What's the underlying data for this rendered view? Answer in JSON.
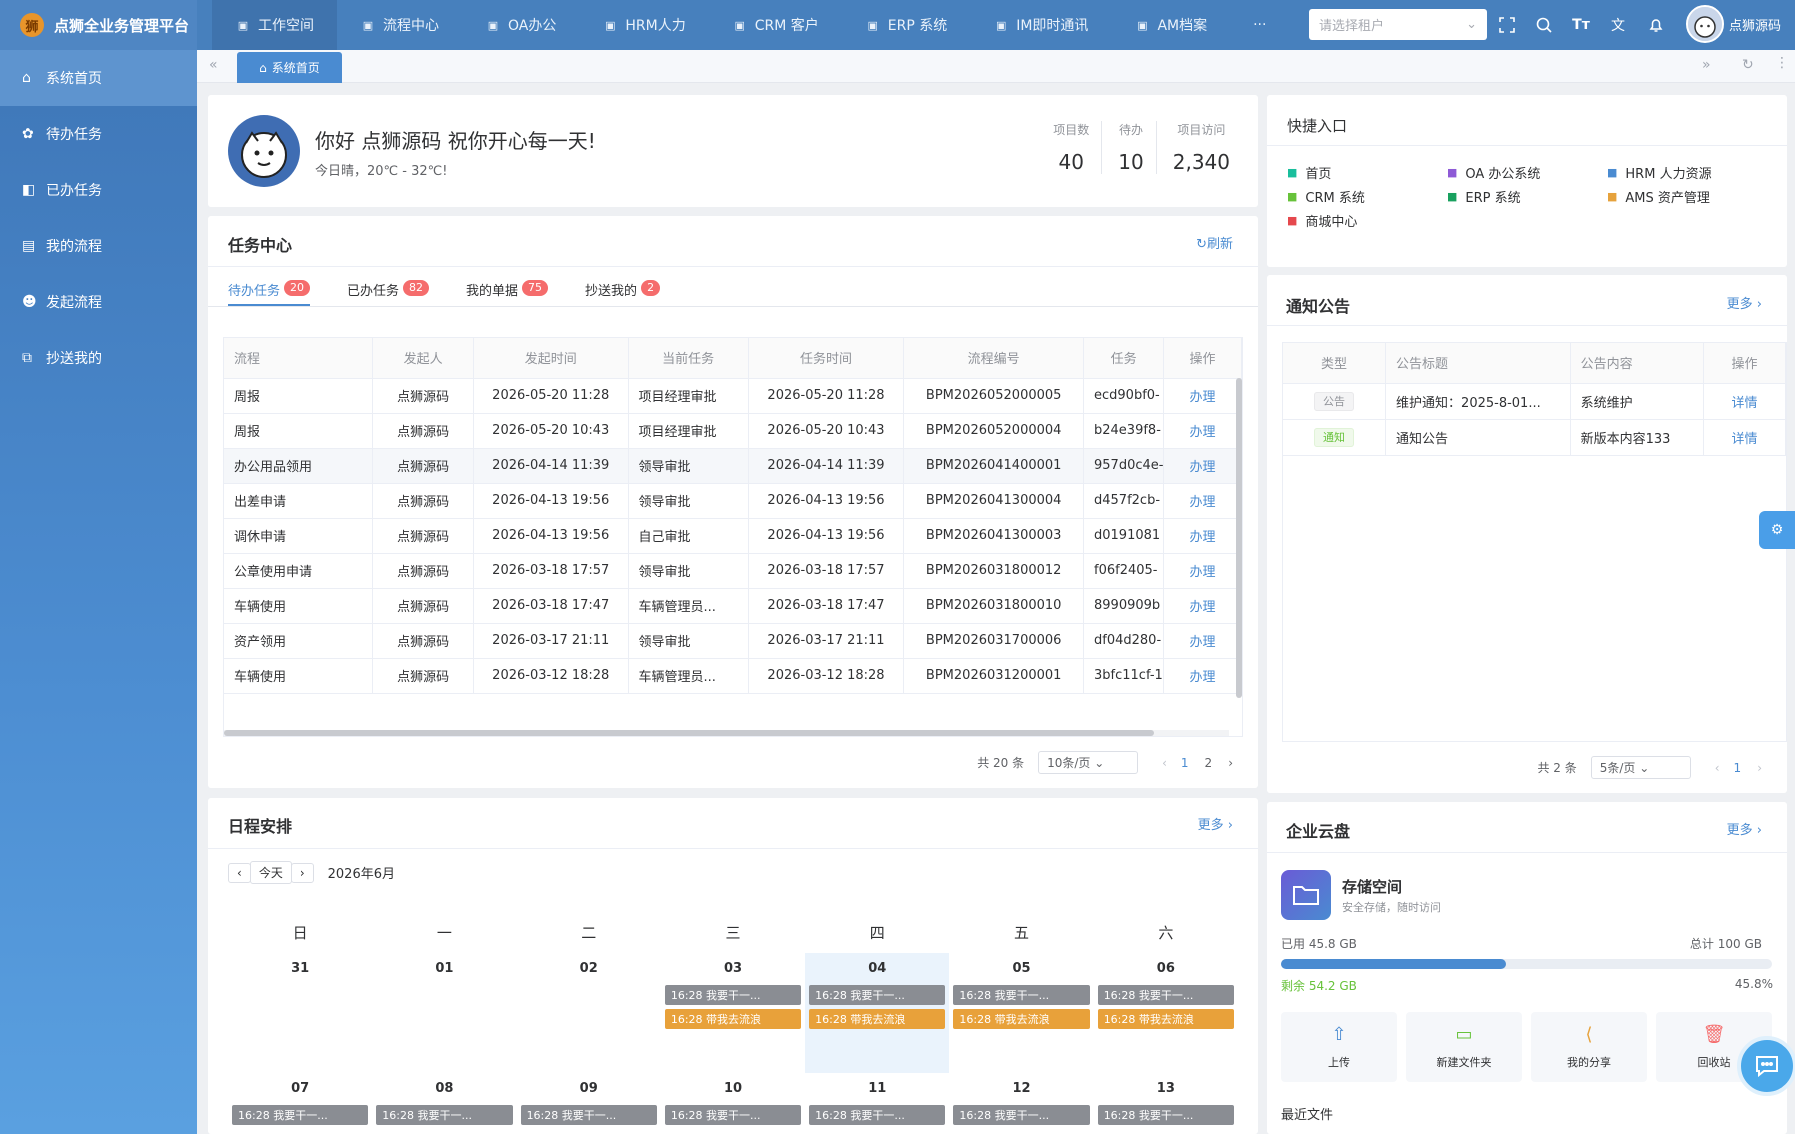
{
  "app": {
    "title": "点狮全业务管理平台",
    "logo_glyph": "狮"
  },
  "topnav": [
    {
      "label": "工作空间",
      "icon": "bird-icon"
    },
    {
      "label": "流程中心",
      "icon": "m-icon"
    },
    {
      "label": "OA办公",
      "icon": "monitor-icon"
    },
    {
      "label": "HRM人力",
      "icon": "person-icon"
    },
    {
      "label": "CRM 客户",
      "icon": "gear-icon"
    },
    {
      "label": "ERP 系统",
      "icon": "palette-icon"
    },
    {
      "label": "IM即时通讯",
      "icon": "chat-icon"
    },
    {
      "label": "AM档案",
      "icon": "folder-icon"
    },
    {
      "label": "···",
      "icon": "more-icon"
    }
  ],
  "tenant": {
    "placeholder": "请选择租户"
  },
  "user": {
    "name": "点狮源码"
  },
  "sidebar": [
    {
      "label": "系统首页"
    },
    {
      "label": "待办任务"
    },
    {
      "label": "已办任务"
    },
    {
      "label": "我的流程"
    },
    {
      "label": "发起流程"
    },
    {
      "label": "抄送我的"
    }
  ],
  "tabs": {
    "home": "系统首页"
  },
  "welcome": {
    "greeting": "你好 点狮源码 祝你开心每一天!",
    "weather": "今日晴，20℃ - 32℃!",
    "stats": [
      {
        "label": "项目数",
        "value": "40"
      },
      {
        "label": "待办",
        "value": "10"
      },
      {
        "label": "项目访问",
        "value": "2,340"
      }
    ]
  },
  "tasks": {
    "title": "任务中心",
    "refresh": "刷新",
    "tabs": [
      {
        "label": "待办任务",
        "count": "20"
      },
      {
        "label": "已办任务",
        "count": "82"
      },
      {
        "label": "我的单据",
        "count": "75"
      },
      {
        "label": "抄送我的",
        "count": "2"
      }
    ],
    "columns": [
      "流程",
      "发起人",
      "发起时间",
      "当前任务",
      "任务时间",
      "流程编号",
      "任务",
      "操作"
    ],
    "rows": [
      [
        "周报",
        "点狮源码",
        "2026-05-20 11:28",
        "项目经理审批",
        "2026-05-20 11:28",
        "BPM2026052000005",
        "ecd90bf0-",
        "办理"
      ],
      [
        "周报",
        "点狮源码",
        "2026-05-20 10:43",
        "项目经理审批",
        "2026-05-20 10:43",
        "BPM2026052000004",
        "b24e39f8-",
        "办理"
      ],
      [
        "办公用品领用",
        "点狮源码",
        "2026-04-14 11:39",
        "领导审批",
        "2026-04-14 11:39",
        "BPM2026041400001",
        "957d0c4e-",
        "办理"
      ],
      [
        "出差申请",
        "点狮源码",
        "2026-04-13 19:56",
        "领导审批",
        "2026-04-13 19:56",
        "BPM2026041300004",
        "d457f2cb-",
        "办理"
      ],
      [
        "调休申请",
        "点狮源码",
        "2026-04-13 19:56",
        "自己审批",
        "2026-04-13 19:56",
        "BPM2026041300003",
        "d0191081",
        "办理"
      ],
      [
        "公章使用申请",
        "点狮源码",
        "2026-03-18 17:57",
        "领导审批",
        "2026-03-18 17:57",
        "BPM2026031800012",
        "f06f2405-",
        "办理"
      ],
      [
        "车辆使用",
        "点狮源码",
        "2026-03-18 17:47",
        "车辆管理员...",
        "2026-03-18 17:47",
        "BPM2026031800010",
        "8990909b",
        "办理"
      ],
      [
        "资产领用",
        "点狮源码",
        "2026-03-17 21:11",
        "领导审批",
        "2026-03-17 21:11",
        "BPM2026031700006",
        "df04d280-",
        "办理"
      ],
      [
        "车辆使用",
        "点狮源码",
        "2026-03-12 18:28",
        "车辆管理员...",
        "2026-03-12 18:28",
        "BPM2026031200001",
        "3bfc11cf-1",
        "办理"
      ]
    ],
    "total": "共 20 条",
    "pagesize": "10条/页",
    "pages": [
      "1",
      "2"
    ]
  },
  "quick": {
    "title": "快捷入口",
    "items": [
      {
        "label": "首页",
        "icon": "home-icon",
        "color": "#19be9c"
      },
      {
        "label": "OA 办公系统",
        "icon": "monitor-icon",
        "color": "#8e5ad6"
      },
      {
        "label": "HRM 人力资源",
        "icon": "sparkle-icon",
        "color": "#4a8bd1"
      },
      {
        "label": "CRM 系统",
        "icon": "user-icon",
        "color": "#67c23a"
      },
      {
        "label": "ERP 系统",
        "icon": "chart-icon",
        "color": "#19a15f"
      },
      {
        "label": "AMS 资产管理",
        "icon": "bag-icon",
        "color": "#e6a23c"
      },
      {
        "label": "商城中心",
        "icon": "cart-icon",
        "color": "#e5484d"
      }
    ]
  },
  "notice": {
    "title": "通知公告",
    "more": "更多",
    "columns": [
      "类型",
      "公告标题",
      "公告内容",
      "操作"
    ],
    "rows": [
      {
        "type": "公告",
        "title": "维护通知：2025-8-01...",
        "content": "系统维护",
        "op": "详情"
      },
      {
        "type": "通知",
        "title": "通知公告",
        "content": "新版本内容133",
        "op": "详情"
      }
    ],
    "total": "共 2 条",
    "pagesize": "5条/页",
    "page": "1"
  },
  "schedule": {
    "title": "日程安排",
    "more": "更多",
    "today": "今天",
    "month": "2026年6月",
    "weekdays": [
      "日",
      "一",
      "二",
      "三",
      "四",
      "五",
      "六"
    ],
    "week1": [
      "31",
      "01",
      "02",
      "03",
      "04",
      "05",
      "06"
    ],
    "week2": [
      "07",
      "08",
      "09",
      "10",
      "11",
      "12",
      "13"
    ],
    "ev1": "16:28 我要干一...",
    "ev2": "16:28 带我去流浪"
  },
  "cloud": {
    "title": "企业云盘",
    "more": "更多",
    "space": "存储空间",
    "sub": "安全存储，随时访问",
    "used": "已用 45.8 GB",
    "total": "总计 100 GB",
    "left": "剩余 54.2 GB",
    "percent": "45.8%",
    "progress": 0.458,
    "actions": [
      {
        "label": "上传",
        "icon": "upload-icon",
        "color": "#4a8bd1"
      },
      {
        "label": "新建文件夹",
        "icon": "folder-add-icon",
        "color": "#67c23a"
      },
      {
        "label": "我的分享",
        "icon": "share-icon",
        "color": "#e6a23c"
      },
      {
        "label": "回收站",
        "icon": "trash-icon",
        "color": "#f56c6c"
      }
    ],
    "recent": "最近文件"
  }
}
